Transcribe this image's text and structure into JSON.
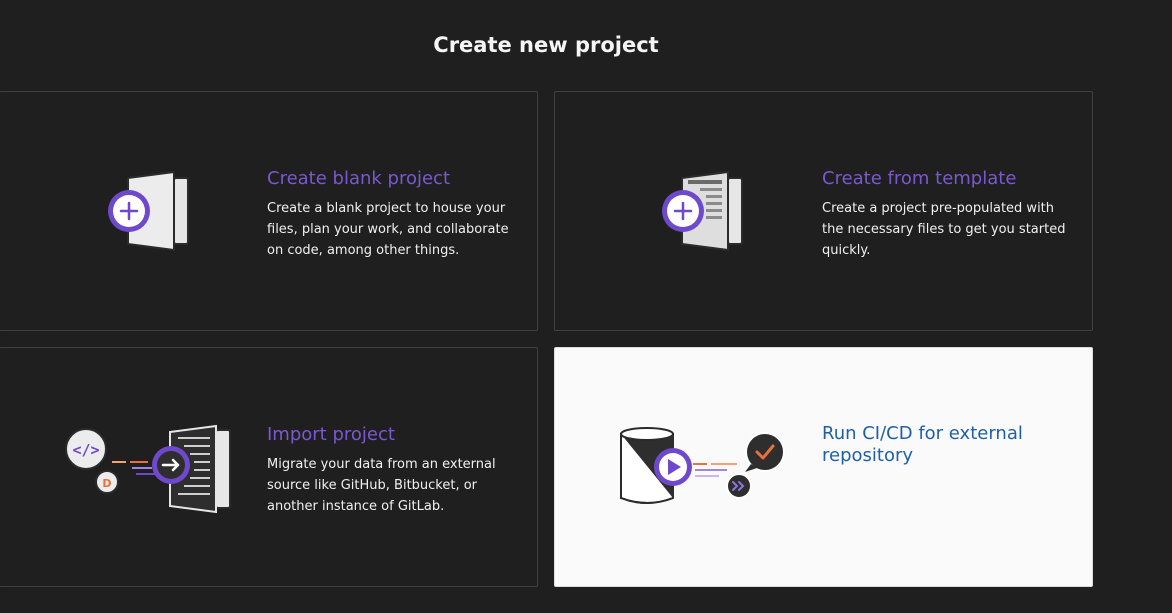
{
  "page": {
    "title": "Create new project"
  },
  "cards": {
    "blank": {
      "title": "Create blank project",
      "description": "Create a blank project to house your files, plan your work, and collaborate on code, among other things."
    },
    "template": {
      "title": "Create from template",
      "description": "Create a project pre-populated with the necessary files to get you started quickly."
    },
    "import": {
      "title": "Import project",
      "description": "Migrate your data from an external source like GitHub, Bitbucket, or another instance of GitLab."
    },
    "cicd": {
      "title": "Run CI/CD for external repository"
    }
  },
  "colors": {
    "accent_purple": "#7b58cf",
    "link_blue": "#1f5fa8",
    "background": "#1f1f1f",
    "card_light": "#fafafb",
    "orange": "#e9703a"
  },
  "icons": {
    "blank": "blank-project-icon",
    "template": "template-project-icon",
    "import": "import-project-icon",
    "cicd": "cicd-external-repo-icon"
  }
}
